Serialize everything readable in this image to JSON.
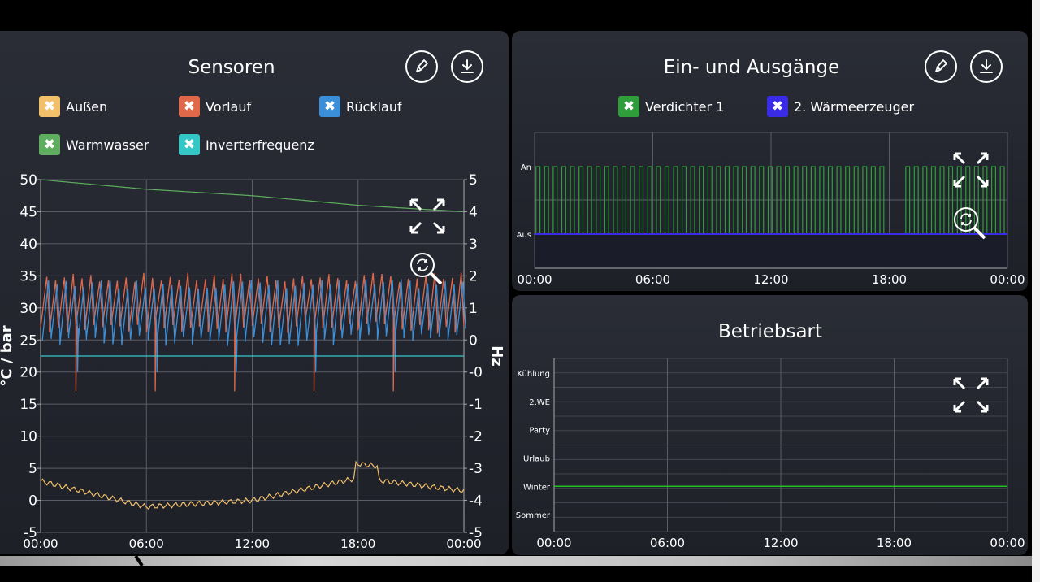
{
  "colors": {
    "aussen": "#f2c06a",
    "vorlauf": "#e0684a",
    "ruecklauf": "#3b8fd8",
    "warmwasser": "#5fae5f",
    "inverter": "#35c6c6",
    "verdichter": "#2f9e3a",
    "waermeerzeuger": "#3a2be6",
    "winter_line": "#22c022"
  },
  "sensoren": {
    "title": "Sensoren",
    "legend": [
      {
        "label": "Außen",
        "color_key": "aussen"
      },
      {
        "label": "Vorlauf",
        "color_key": "vorlauf"
      },
      {
        "label": "Rücklauf",
        "color_key": "ruecklauf"
      },
      {
        "label": "Warmwasser",
        "color_key": "warmwasser"
      },
      {
        "label": "Inverterfrequenz",
        "color_key": "inverter"
      }
    ],
    "y_left_label": "°C / bar",
    "y_right_label": "Hz",
    "y_left_ticks": [
      "50",
      "45",
      "40",
      "35",
      "30",
      "25",
      "20",
      "15",
      "10",
      "5",
      "0",
      "-5"
    ],
    "y_right_ticks": [
      "5",
      "4",
      "3",
      "2",
      "1",
      "0",
      "-0",
      "-1",
      "-2",
      "-3",
      "-4",
      "-5"
    ],
    "x_ticks": [
      "00:00",
      "06:00",
      "12:00",
      "18:00",
      "00:00"
    ]
  },
  "io": {
    "title": "Ein- und Ausgänge",
    "legend": [
      {
        "label": "Verdichter 1",
        "color_key": "verdichter"
      },
      {
        "label": "2. Wärmeerzeuger",
        "color_key": "waermeerzeuger"
      }
    ],
    "y_ticks": [
      "An",
      "Aus"
    ],
    "x_ticks": [
      "00:00",
      "06:00",
      "12:00",
      "18:00",
      "00:00"
    ]
  },
  "mode": {
    "title": "Betriebsart",
    "y_ticks": [
      "Kühlung",
      "2.WE",
      "Party",
      "Urlaub",
      "Winter",
      "Sommer"
    ],
    "x_ticks": [
      "00:00",
      "06:00",
      "12:00",
      "18:00",
      "00:00"
    ]
  },
  "chart_data": [
    {
      "type": "line",
      "title": "Sensoren",
      "x": [
        "00:00",
        "06:00",
        "12:00",
        "18:00",
        "00:00"
      ],
      "ylim": [
        -5,
        50
      ],
      "y2lim": [
        -5,
        5
      ],
      "ylabel": "°C / bar",
      "y2label": "Hz",
      "grid": true,
      "series": [
        {
          "name": "Warmwasser",
          "values": [
            50,
            48.5,
            47.5,
            46,
            45
          ]
        },
        {
          "name": "Vorlauf",
          "values": [
            30,
            30,
            30,
            30,
            30
          ]
        },
        {
          "name": "Rücklauf",
          "values": [
            28,
            28,
            28,
            28,
            28
          ]
        },
        {
          "name": "Inverterfrequenz",
          "values": [
            22.5,
            22.5,
            22.5,
            22.5,
            22.5
          ]
        },
        {
          "name": "Außen",
          "values": [
            3,
            -1,
            0,
            3.5,
            1.5
          ]
        }
      ]
    },
    {
      "type": "line",
      "title": "Ein- und Ausgänge",
      "x": [
        "00:00",
        "06:00",
        "12:00",
        "18:00",
        "00:00"
      ],
      "y_categories": [
        "Aus",
        "An"
      ],
      "grid": true,
      "series": [
        {
          "name": "Verdichter 1",
          "values": [
            "An",
            "An",
            "An",
            "An",
            "An"
          ]
        },
        {
          "name": "2. Wärmeerzeuger",
          "values": [
            "Aus",
            "Aus",
            "Aus",
            "Aus",
            "Aus"
          ]
        }
      ]
    },
    {
      "type": "line",
      "title": "Betriebsart",
      "x": [
        "00:00",
        "06:00",
        "12:00",
        "18:00",
        "00:00"
      ],
      "y_categories": [
        "Sommer",
        "Winter",
        "Urlaub",
        "Party",
        "2.WE",
        "Kühlung"
      ],
      "grid": true,
      "series": [
        {
          "values": [
            "Winter",
            "Winter",
            "Winter",
            "Winter",
            "Winter"
          ]
        }
      ]
    }
  ]
}
